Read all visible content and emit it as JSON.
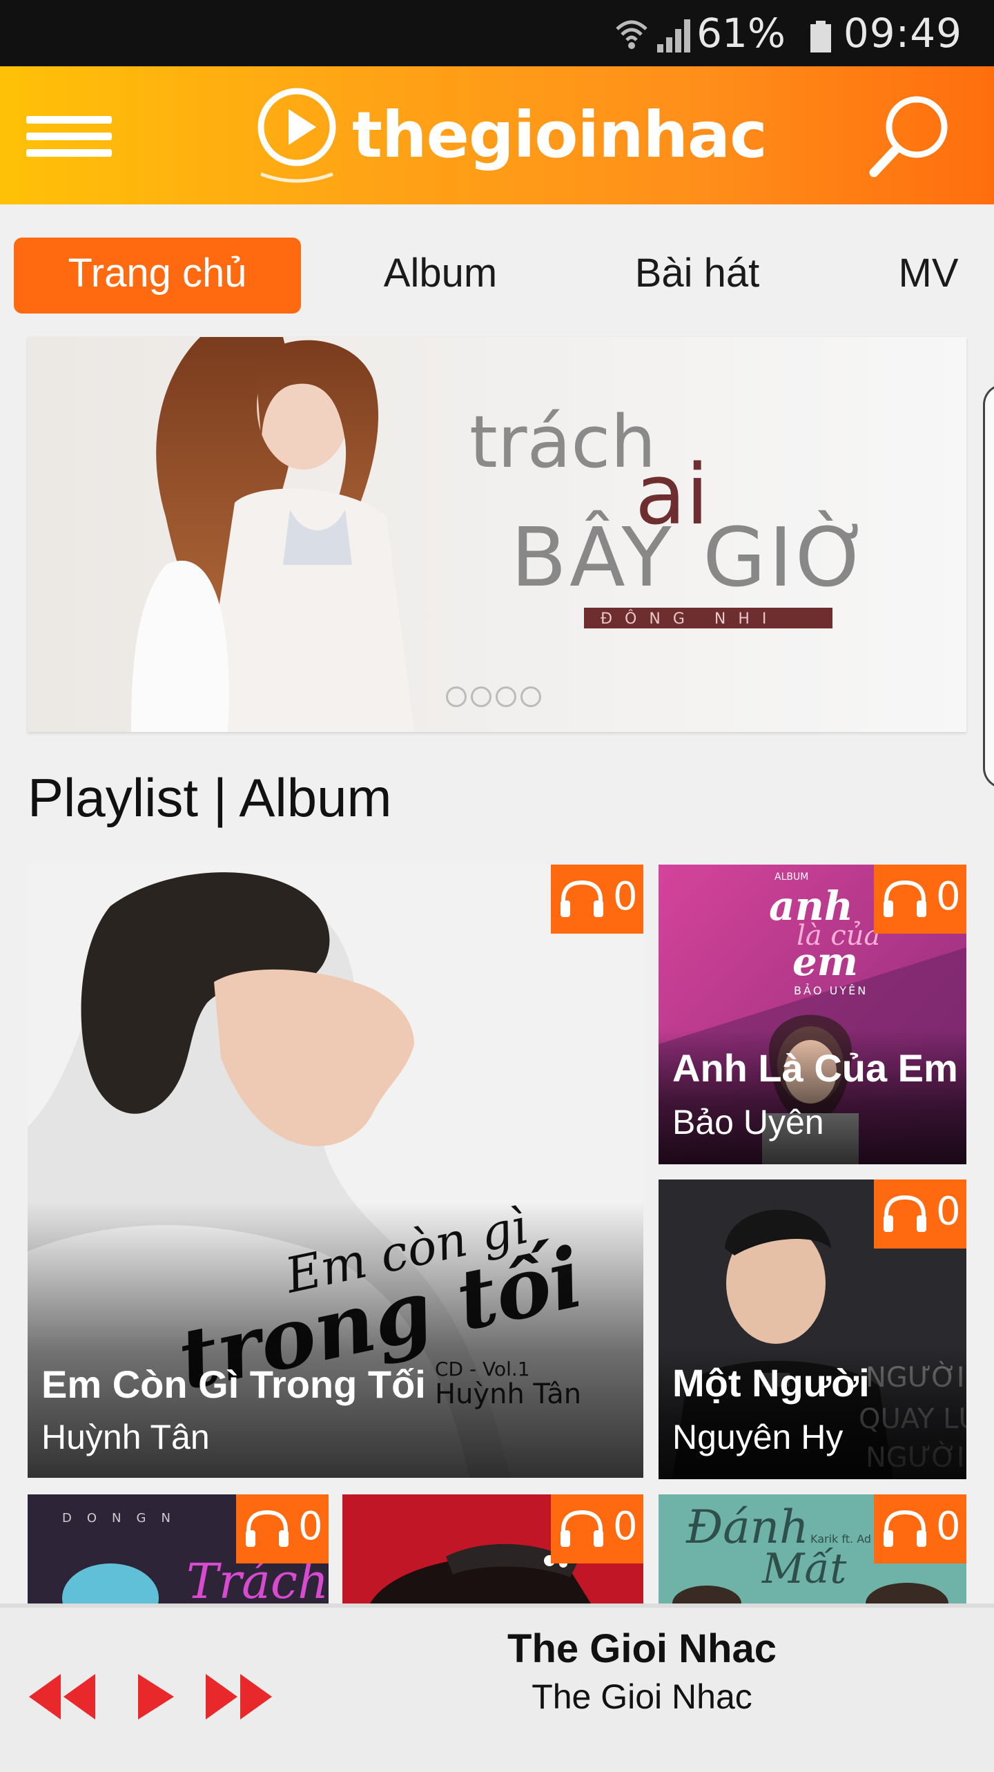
{
  "status_bar": {
    "battery": "61%",
    "time": "09:49"
  },
  "header": {
    "logo_text": "thegioinhac"
  },
  "tabs": [
    {
      "label": "Trang chủ",
      "active": true
    },
    {
      "label": "Album",
      "active": false
    },
    {
      "label": "Bài hát",
      "active": false
    },
    {
      "label": "MV",
      "active": false
    }
  ],
  "banner": {
    "line1": "trách",
    "line2": "ai",
    "line3": "BÂY GIỜ",
    "artist": "ĐÔNG NHI",
    "slide_count": 4
  },
  "section": {
    "title": "Playlist | Album"
  },
  "cards": [
    {
      "title": "Em Còn Gì Trong Tối",
      "artist": "Huỳnh Tân",
      "plays": "0",
      "art_script": "Em còn gì",
      "art_script2": "trong tối",
      "art_sub": "CD - Vol.1",
      "art_sub2": "Huỳnh Tân"
    },
    {
      "title": "Anh Là Của Em",
      "artist": "Bảo Uyên",
      "plays": "0",
      "art_text": "anh là của em",
      "art_sub": "BẢO UYÊN",
      "art_top": "ALBUM"
    },
    {
      "title": "Một Người",
      "artist": "Nguyên Hy",
      "plays": "0",
      "art_text": "NGƯỜI QUAY LƯNG NGƯỜI"
    },
    {
      "plays": "0",
      "art_text": "D O N G N",
      "art_script": "Trách"
    },
    {
      "plays": "0"
    },
    {
      "plays": "0",
      "art_script": "Đánh Mất",
      "art_sub": "Karik ft. Ad"
    }
  ],
  "player": {
    "title": "The Gioi Nhac",
    "artist": "The Gioi Nhac"
  },
  "colors": {
    "accent": "#ff6a10",
    "header_start": "#ffc107",
    "header_end": "#ff6e0d",
    "player_controls": "#e8282b"
  }
}
